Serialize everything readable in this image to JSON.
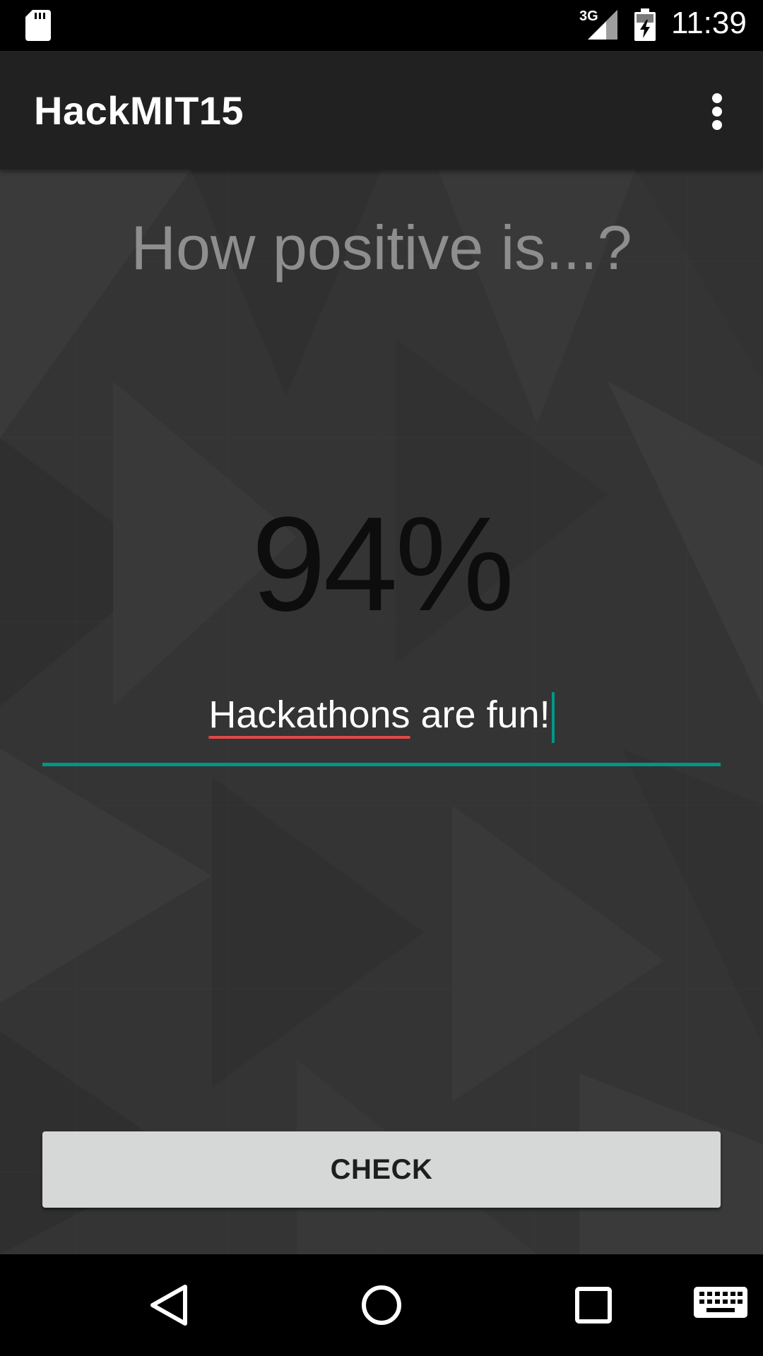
{
  "status_bar": {
    "time": "11:39",
    "network": "3G",
    "icons": [
      "sd-card-icon",
      "signal-icon",
      "battery-charging-icon"
    ]
  },
  "app_bar": {
    "title": "HackMIT15",
    "menu_icon": "overflow-menu-icon"
  },
  "main": {
    "question": "How positive is...?",
    "score": "94%",
    "input": {
      "value": "Hackathons are fun!",
      "misspelled_word": "Hackathons",
      "rest_of_text": " are fun!",
      "placeholder": ""
    },
    "check_button_label": "CHECK"
  },
  "nav_bar": {
    "buttons": [
      "back-icon",
      "home-icon",
      "recents-icon",
      "keyboard-icon"
    ]
  },
  "colors": {
    "accent": "#009688",
    "app_bar": "#212121",
    "background": "#343434",
    "spellcheck": "#e0484a",
    "button": "#d6d7d7"
  }
}
